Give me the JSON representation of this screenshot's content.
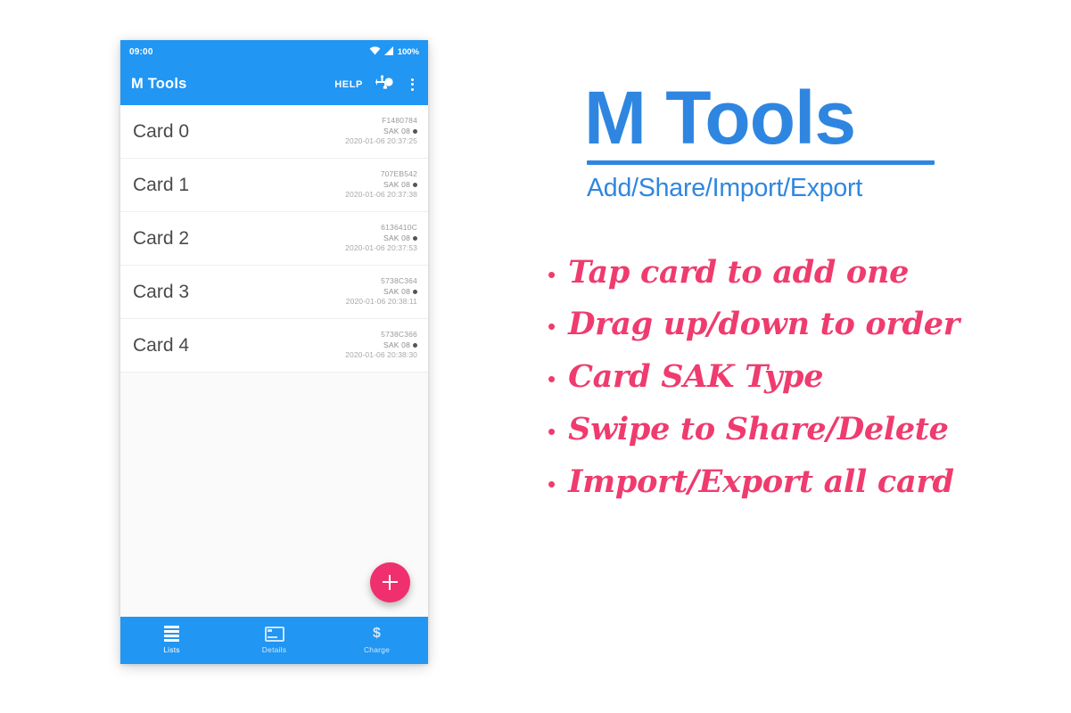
{
  "phone": {
    "status_bar": {
      "time": "09:00",
      "battery": "100%",
      "wifi_icon": "wifi-icon",
      "signal_icon": "signal-icon"
    },
    "app_bar": {
      "title": "M Tools",
      "help_label": "HELP",
      "usb_icon": "usb-icon",
      "overflow_icon": "overflow-menu-icon"
    },
    "cards": [
      {
        "name": "Card 0",
        "uid": "F1480784",
        "sak": "SAK 08",
        "timestamp": "2020-01-06 20:37:25"
      },
      {
        "name": "Card 1",
        "uid": "707EB542",
        "sak": "SAK 08",
        "timestamp": "2020-01-06 20:37:38"
      },
      {
        "name": "Card 2",
        "uid": "6136410C",
        "sak": "SAK 08",
        "timestamp": "2020-01-06 20:37:53"
      },
      {
        "name": "Card 3",
        "uid": "5738C364",
        "sak": "SAK 08",
        "timestamp": "2020-01-06 20:38:11"
      },
      {
        "name": "Card 4",
        "uid": "5738C366",
        "sak": "SAK 08",
        "timestamp": "2020-01-06 20:38:30"
      }
    ],
    "fab": {
      "icon": "plus-icon",
      "color": "#f0306e"
    },
    "bottom_nav": [
      {
        "label": "Lists",
        "icon": "list-icon",
        "active": true
      },
      {
        "label": "Details",
        "icon": "card-details-icon",
        "active": false
      },
      {
        "label": "Charge",
        "icon": "dollar-icon",
        "active": false
      }
    ]
  },
  "promo": {
    "title": "M Tools",
    "subtitle": "Add/Share/Import/Export",
    "features": [
      "Tap card to add one",
      "Drag up/down to order",
      "Card SAK Type",
      "Swipe to Share/Delete",
      "Import/Export all card"
    ],
    "bullet": "•",
    "brand_color": "#2f86e0",
    "feature_color": "#ef3b6e"
  }
}
